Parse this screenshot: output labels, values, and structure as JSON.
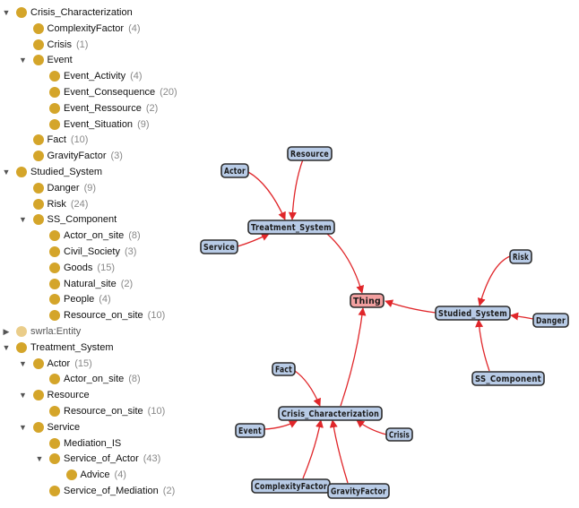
{
  "colors": {
    "class_dot": "#d4a52a",
    "class_dot_inferred": "#eacd8a",
    "node_fill": "#b8cbe6",
    "root_node_fill": "#f2a0a0",
    "edge": "#e0262a"
  },
  "tree": [
    {
      "label": "Crisis_Characterization",
      "count": "",
      "level": 0,
      "toggle": "expanded"
    },
    {
      "label": "ComplexityFactor",
      "count": "(4)",
      "level": 1,
      "toggle": "none"
    },
    {
      "label": "Crisis",
      "count": "(1)",
      "level": 1,
      "toggle": "none"
    },
    {
      "label": "Event",
      "count": "",
      "level": 1,
      "toggle": "expanded"
    },
    {
      "label": "Event_Activity",
      "count": "(4)",
      "level": 2,
      "toggle": "none"
    },
    {
      "label": "Event_Consequence",
      "count": "(20)",
      "level": 2,
      "toggle": "none"
    },
    {
      "label": "Event_Ressource",
      "count": "(2)",
      "level": 2,
      "toggle": "none"
    },
    {
      "label": "Event_Situation",
      "count": "(9)",
      "level": 2,
      "toggle": "none"
    },
    {
      "label": "Fact",
      "count": "(10)",
      "level": 1,
      "toggle": "none"
    },
    {
      "label": "GravityFactor",
      "count": "(3)",
      "level": 1,
      "toggle": "none"
    },
    {
      "label": "Studied_System",
      "count": "",
      "level": 0,
      "toggle": "expanded"
    },
    {
      "label": "Danger",
      "count": "(9)",
      "level": 1,
      "toggle": "none"
    },
    {
      "label": "Risk",
      "count": "(24)",
      "level": 1,
      "toggle": "none"
    },
    {
      "label": "SS_Component",
      "count": "",
      "level": 1,
      "toggle": "expanded"
    },
    {
      "label": "Actor_on_site",
      "count": "(8)",
      "level": 2,
      "toggle": "none"
    },
    {
      "label": "Civil_Society",
      "count": "(3)",
      "level": 2,
      "toggle": "none"
    },
    {
      "label": "Goods",
      "count": "(15)",
      "level": 2,
      "toggle": "none"
    },
    {
      "label": "Natural_site",
      "count": "(2)",
      "level": 2,
      "toggle": "none"
    },
    {
      "label": "People",
      "count": "(4)",
      "level": 2,
      "toggle": "none"
    },
    {
      "label": "Resource_on_site",
      "count": "(10)",
      "level": 2,
      "toggle": "none"
    },
    {
      "label": "swrla:Entity",
      "count": "",
      "level": 0,
      "toggle": "collapsed",
      "light": true
    },
    {
      "label": "Treatment_System",
      "count": "",
      "level": 0,
      "toggle": "expanded"
    },
    {
      "label": "Actor",
      "count": "(15)",
      "level": 1,
      "toggle": "expanded"
    },
    {
      "label": "Actor_on_site",
      "count": "(8)",
      "level": 2,
      "toggle": "none"
    },
    {
      "label": "Resource",
      "count": "",
      "level": 1,
      "toggle": "expanded"
    },
    {
      "label": "Resource_on_site",
      "count": "(10)",
      "level": 2,
      "toggle": "none"
    },
    {
      "label": "Service",
      "count": "",
      "level": 1,
      "toggle": "expanded"
    },
    {
      "label": "Mediation_IS",
      "count": "",
      "level": 2,
      "toggle": "none"
    },
    {
      "label": "Service_of_Actor",
      "count": "(43)",
      "level": 2,
      "toggle": "expanded"
    },
    {
      "label": "Advice",
      "count": "(4)",
      "level": 3,
      "toggle": "none"
    },
    {
      "label": "Service_of_Mediation",
      "count": "(2)",
      "level": 2,
      "toggle": "none"
    }
  ],
  "graph": {
    "nodes": [
      {
        "id": "Thing",
        "label": "Thing",
        "root": true
      },
      {
        "id": "Treatment_System",
        "label": "Treatment_System"
      },
      {
        "id": "Actor",
        "label": "Actor"
      },
      {
        "id": "Resource",
        "label": "Resource"
      },
      {
        "id": "Service",
        "label": "Service"
      },
      {
        "id": "Studied_System",
        "label": "Studied_System"
      },
      {
        "id": "Risk",
        "label": "Risk"
      },
      {
        "id": "Danger",
        "label": "Danger"
      },
      {
        "id": "SS_Component",
        "label": "SS_Component"
      },
      {
        "id": "Crisis_Characterization",
        "label": "Crisis_Characterization"
      },
      {
        "id": "Fact",
        "label": "Fact"
      },
      {
        "id": "Event",
        "label": "Event"
      },
      {
        "id": "Crisis",
        "label": "Crisis"
      },
      {
        "id": "ComplexityFactor",
        "label": "ComplexityFactor"
      },
      {
        "id": "GravityFactor",
        "label": "GravityFactor"
      }
    ],
    "edges": [
      {
        "from": "Treatment_System",
        "to": "Thing"
      },
      {
        "from": "Studied_System",
        "to": "Thing"
      },
      {
        "from": "Crisis_Characterization",
        "to": "Thing"
      },
      {
        "from": "Actor",
        "to": "Treatment_System"
      },
      {
        "from": "Resource",
        "to": "Treatment_System"
      },
      {
        "from": "Service",
        "to": "Treatment_System"
      },
      {
        "from": "Risk",
        "to": "Studied_System"
      },
      {
        "from": "Danger",
        "to": "Studied_System"
      },
      {
        "from": "SS_Component",
        "to": "Studied_System"
      },
      {
        "from": "Fact",
        "to": "Crisis_Characterization"
      },
      {
        "from": "Event",
        "to": "Crisis_Characterization"
      },
      {
        "from": "Crisis",
        "to": "Crisis_Characterization"
      },
      {
        "from": "ComplexityFactor",
        "to": "Crisis_Characterization"
      },
      {
        "from": "GravityFactor",
        "to": "Crisis_Characterization"
      }
    ]
  }
}
